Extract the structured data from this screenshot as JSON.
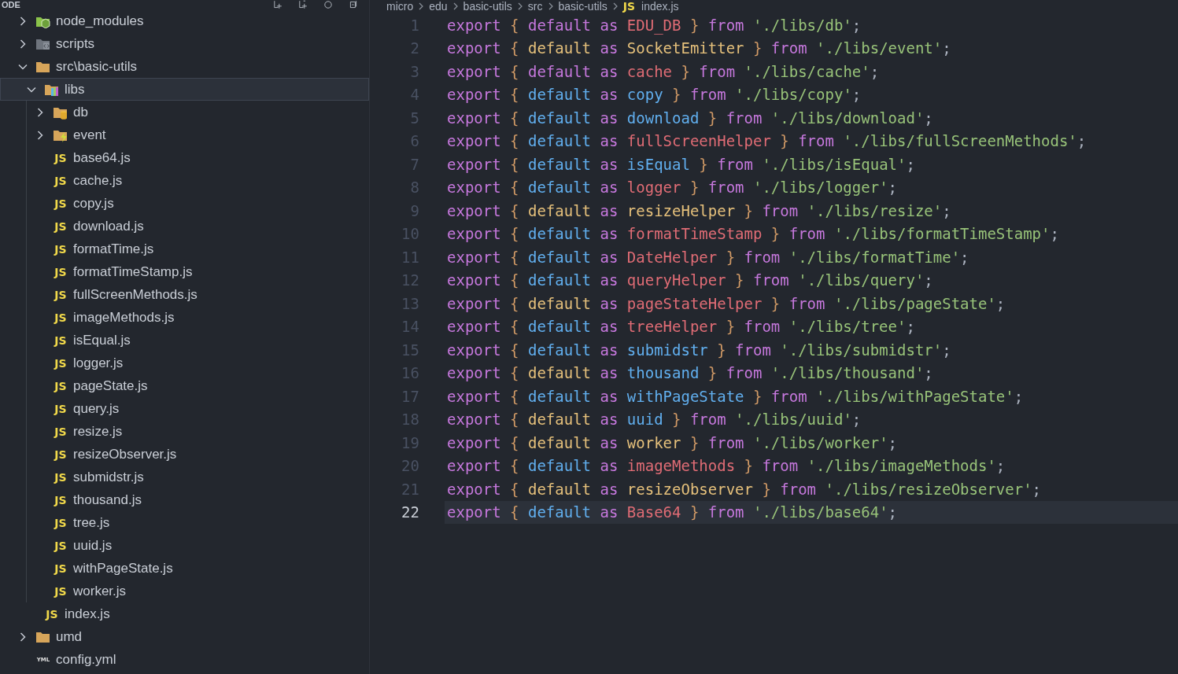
{
  "explorer": {
    "title": "ODE",
    "tree": [
      {
        "label": "node_modules",
        "kind": "node-folder",
        "expanded": false,
        "selected": false
      },
      {
        "label": "scripts",
        "kind": "script-folder",
        "expanded": false,
        "selected": false
      },
      {
        "label": "src\\basic-utils",
        "kind": "folder",
        "expanded": true,
        "selected": false,
        "children": [
          {
            "label": "libs",
            "kind": "lib-folder",
            "expanded": true,
            "selected": true,
            "children": [
              {
                "label": "db",
                "kind": "db-folder",
                "expanded": false,
                "selected": false
              },
              {
                "label": "event",
                "kind": "event-folder",
                "expanded": false,
                "selected": false
              },
              {
                "label": "base64.js",
                "kind": "file",
                "badge": "JS",
                "selected": false
              },
              {
                "label": "cache.js",
                "kind": "file",
                "badge": "JS",
                "selected": false
              },
              {
                "label": "copy.js",
                "kind": "file",
                "badge": "JS",
                "selected": false
              },
              {
                "label": "download.js",
                "kind": "file",
                "badge": "JS",
                "selected": false
              },
              {
                "label": "formatTime.js",
                "kind": "file",
                "badge": "JS",
                "selected": false
              },
              {
                "label": "formatTimeStamp.js",
                "kind": "file",
                "badge": "JS",
                "selected": false
              },
              {
                "label": "fullScreenMethods.js",
                "kind": "file",
                "badge": "JS",
                "selected": false
              },
              {
                "label": "imageMethods.js",
                "kind": "file",
                "badge": "JS",
                "selected": false
              },
              {
                "label": "isEqual.js",
                "kind": "file",
                "badge": "JS",
                "selected": false
              },
              {
                "label": "logger.js",
                "kind": "file",
                "badge": "JS",
                "selected": false
              },
              {
                "label": "pageState.js",
                "kind": "file",
                "badge": "JS",
                "selected": false
              },
              {
                "label": "query.js",
                "kind": "file",
                "badge": "JS",
                "selected": false
              },
              {
                "label": "resize.js",
                "kind": "file",
                "badge": "JS",
                "selected": false
              },
              {
                "label": "resizeObserver.js",
                "kind": "file",
                "badge": "JS",
                "selected": false
              },
              {
                "label": "submidstr.js",
                "kind": "file",
                "badge": "JS",
                "selected": false
              },
              {
                "label": "thousand.js",
                "kind": "file",
                "badge": "JS",
                "selected": false
              },
              {
                "label": "tree.js",
                "kind": "file",
                "badge": "JS",
                "selected": false
              },
              {
                "label": "uuid.js",
                "kind": "file",
                "badge": "JS",
                "selected": false
              },
              {
                "label": "withPageState.js",
                "kind": "file",
                "badge": "JS",
                "selected": false
              },
              {
                "label": "worker.js",
                "kind": "file",
                "badge": "JS",
                "selected": false
              }
            ]
          },
          {
            "label": "index.js",
            "kind": "file",
            "badge": "JS",
            "selected": false
          }
        ]
      },
      {
        "label": "umd",
        "kind": "folder",
        "expanded": false,
        "selected": false
      },
      {
        "label": "config.yml",
        "kind": "file",
        "badge": "YML",
        "selected": false
      }
    ]
  },
  "editor": {
    "breadcrumbs": [
      {
        "text": "micro"
      },
      {
        "text": "edu"
      },
      {
        "text": "basic-utils"
      },
      {
        "text": "src"
      },
      {
        "text": "basic-utils"
      },
      {
        "text": "index.js",
        "badge": "JS"
      }
    ],
    "lines": [
      {
        "number": "1",
        "current": false,
        "end": ";",
        "tokens": [
          {
            "text": "export",
            "color": "#c678dd"
          },
          {
            "text": "{",
            "color": "#d19a66"
          },
          {
            "text": "default",
            "color": "#c678dd"
          },
          {
            "text": "as",
            "color": "#c678dd"
          },
          {
            "text": "EDU_DB",
            "color": "#e06c75"
          },
          {
            "text": "}",
            "color": "#d19a66"
          },
          {
            "text": "from",
            "color": "#c678dd"
          },
          {
            "text": "'./libs/db'",
            "color": "#98c379"
          }
        ]
      },
      {
        "number": "2",
        "current": false,
        "end": ";",
        "tokens": [
          {
            "text": "export",
            "color": "#c678dd"
          },
          {
            "text": "{",
            "color": "#d19a66"
          },
          {
            "text": "default",
            "color": "#e5c07b"
          },
          {
            "text": "as",
            "color": "#c678dd"
          },
          {
            "text": "SocketEmitter",
            "color": "#e5c07b"
          },
          {
            "text": "}",
            "color": "#d19a66"
          },
          {
            "text": "from",
            "color": "#c678dd"
          },
          {
            "text": "'./libs/event'",
            "color": "#98c379"
          }
        ]
      },
      {
        "number": "3",
        "current": false,
        "end": ";",
        "tokens": [
          {
            "text": "export",
            "color": "#c678dd"
          },
          {
            "text": "{",
            "color": "#d19a66"
          },
          {
            "text": "default",
            "color": "#c678dd"
          },
          {
            "text": "as",
            "color": "#c678dd"
          },
          {
            "text": "cache",
            "color": "#e06c75"
          },
          {
            "text": "}",
            "color": "#d19a66"
          },
          {
            "text": "from",
            "color": "#c678dd"
          },
          {
            "text": "'./libs/cache'",
            "color": "#98c379"
          }
        ]
      },
      {
        "number": "4",
        "current": false,
        "end": ";",
        "tokens": [
          {
            "text": "export",
            "color": "#c678dd"
          },
          {
            "text": "{",
            "color": "#d19a66"
          },
          {
            "text": "default",
            "color": "#61afef"
          },
          {
            "text": "as",
            "color": "#c678dd"
          },
          {
            "text": "copy",
            "color": "#61afef"
          },
          {
            "text": "}",
            "color": "#d19a66"
          },
          {
            "text": "from",
            "color": "#c678dd"
          },
          {
            "text": "'./libs/copy'",
            "color": "#98c379"
          }
        ]
      },
      {
        "number": "5",
        "current": false,
        "end": ";",
        "tokens": [
          {
            "text": "export",
            "color": "#c678dd"
          },
          {
            "text": "{",
            "color": "#d19a66"
          },
          {
            "text": "default",
            "color": "#61afef"
          },
          {
            "text": "as",
            "color": "#c678dd"
          },
          {
            "text": "download",
            "color": "#61afef"
          },
          {
            "text": "}",
            "color": "#d19a66"
          },
          {
            "text": "from",
            "color": "#c678dd"
          },
          {
            "text": "'./libs/download'",
            "color": "#98c379"
          }
        ]
      },
      {
        "number": "6",
        "current": false,
        "end": ";",
        "tokens": [
          {
            "text": "export",
            "color": "#c678dd"
          },
          {
            "text": "{",
            "color": "#d19a66"
          },
          {
            "text": "default",
            "color": "#61afef"
          },
          {
            "text": "as",
            "color": "#c678dd"
          },
          {
            "text": "fullScreenHelper",
            "color": "#e06c75"
          },
          {
            "text": "}",
            "color": "#d19a66"
          },
          {
            "text": "from",
            "color": "#c678dd"
          },
          {
            "text": "'./libs/fullScreenMethods'",
            "color": "#98c379"
          }
        ]
      },
      {
        "number": "7",
        "current": false,
        "end": ";",
        "tokens": [
          {
            "text": "export",
            "color": "#c678dd"
          },
          {
            "text": "{",
            "color": "#d19a66"
          },
          {
            "text": "default",
            "color": "#61afef"
          },
          {
            "text": "as",
            "color": "#c678dd"
          },
          {
            "text": "isEqual",
            "color": "#61afef"
          },
          {
            "text": "}",
            "color": "#d19a66"
          },
          {
            "text": "from",
            "color": "#c678dd"
          },
          {
            "text": "'./libs/isEqual'",
            "color": "#98c379"
          }
        ]
      },
      {
        "number": "8",
        "current": false,
        "end": ";",
        "tokens": [
          {
            "text": "export",
            "color": "#c678dd"
          },
          {
            "text": "{",
            "color": "#d19a66"
          },
          {
            "text": "default",
            "color": "#61afef"
          },
          {
            "text": "as",
            "color": "#c678dd"
          },
          {
            "text": "logger",
            "color": "#e06c75"
          },
          {
            "text": "}",
            "color": "#d19a66"
          },
          {
            "text": "from",
            "color": "#c678dd"
          },
          {
            "text": "'./libs/logger'",
            "color": "#98c379"
          }
        ]
      },
      {
        "number": "9",
        "current": false,
        "end": ";",
        "tokens": [
          {
            "text": "export",
            "color": "#c678dd"
          },
          {
            "text": "{",
            "color": "#d19a66"
          },
          {
            "text": "default",
            "color": "#e5c07b"
          },
          {
            "text": "as",
            "color": "#c678dd"
          },
          {
            "text": "resizeHelper",
            "color": "#e5c07b"
          },
          {
            "text": "}",
            "color": "#d19a66"
          },
          {
            "text": "from",
            "color": "#c678dd"
          },
          {
            "text": "'./libs/resize'",
            "color": "#98c379"
          }
        ]
      },
      {
        "number": "10",
        "current": false,
        "end": ";",
        "tokens": [
          {
            "text": "export",
            "color": "#c678dd"
          },
          {
            "text": "{",
            "color": "#d19a66"
          },
          {
            "text": "default",
            "color": "#61afef"
          },
          {
            "text": "as",
            "color": "#c678dd"
          },
          {
            "text": "formatTimeStamp",
            "color": "#e06c75"
          },
          {
            "text": "}",
            "color": "#d19a66"
          },
          {
            "text": "from",
            "color": "#c678dd"
          },
          {
            "text": "'./libs/formatTimeStamp'",
            "color": "#98c379"
          }
        ]
      },
      {
        "number": "11",
        "current": false,
        "end": ";",
        "tokens": [
          {
            "text": "export",
            "color": "#c678dd"
          },
          {
            "text": "{",
            "color": "#d19a66"
          },
          {
            "text": "default",
            "color": "#61afef"
          },
          {
            "text": "as",
            "color": "#c678dd"
          },
          {
            "text": "DateHelper",
            "color": "#e06c75"
          },
          {
            "text": "}",
            "color": "#d19a66"
          },
          {
            "text": "from",
            "color": "#c678dd"
          },
          {
            "text": "'./libs/formatTime'",
            "color": "#98c379"
          }
        ]
      },
      {
        "number": "12",
        "current": false,
        "end": ";",
        "tokens": [
          {
            "text": "export",
            "color": "#c678dd"
          },
          {
            "text": "{",
            "color": "#d19a66"
          },
          {
            "text": "default",
            "color": "#61afef"
          },
          {
            "text": "as",
            "color": "#c678dd"
          },
          {
            "text": "queryHelper",
            "color": "#e06c75"
          },
          {
            "text": "}",
            "color": "#d19a66"
          },
          {
            "text": "from",
            "color": "#c678dd"
          },
          {
            "text": "'./libs/query'",
            "color": "#98c379"
          }
        ]
      },
      {
        "number": "13",
        "current": false,
        "end": ";",
        "tokens": [
          {
            "text": "export",
            "color": "#c678dd"
          },
          {
            "text": "{",
            "color": "#d19a66"
          },
          {
            "text": "default",
            "color": "#e5c07b"
          },
          {
            "text": "as",
            "color": "#c678dd"
          },
          {
            "text": "pageStateHelper",
            "color": "#e06c75"
          },
          {
            "text": "}",
            "color": "#d19a66"
          },
          {
            "text": "from",
            "color": "#c678dd"
          },
          {
            "text": "'./libs/pageState'",
            "color": "#98c379"
          }
        ]
      },
      {
        "number": "14",
        "current": false,
        "end": ";",
        "tokens": [
          {
            "text": "export",
            "color": "#c678dd"
          },
          {
            "text": "{",
            "color": "#d19a66"
          },
          {
            "text": "default",
            "color": "#61afef"
          },
          {
            "text": "as",
            "color": "#c678dd"
          },
          {
            "text": "treeHelper",
            "color": "#e06c75"
          },
          {
            "text": "}",
            "color": "#d19a66"
          },
          {
            "text": "from",
            "color": "#c678dd"
          },
          {
            "text": "'./libs/tree'",
            "color": "#98c379"
          }
        ]
      },
      {
        "number": "15",
        "current": false,
        "end": ";",
        "tokens": [
          {
            "text": "export",
            "color": "#c678dd"
          },
          {
            "text": "{",
            "color": "#d19a66"
          },
          {
            "text": "default",
            "color": "#61afef"
          },
          {
            "text": "as",
            "color": "#c678dd"
          },
          {
            "text": "submidstr",
            "color": "#61afef"
          },
          {
            "text": "}",
            "color": "#d19a66"
          },
          {
            "text": "from",
            "color": "#c678dd"
          },
          {
            "text": "'./libs/submidstr'",
            "color": "#98c379"
          }
        ]
      },
      {
        "number": "16",
        "current": false,
        "end": ";",
        "tokens": [
          {
            "text": "export",
            "color": "#c678dd"
          },
          {
            "text": "{",
            "color": "#d19a66"
          },
          {
            "text": "default",
            "color": "#e5c07b"
          },
          {
            "text": "as",
            "color": "#c678dd"
          },
          {
            "text": "thousand",
            "color": "#61afef"
          },
          {
            "text": "}",
            "color": "#d19a66"
          },
          {
            "text": "from",
            "color": "#c678dd"
          },
          {
            "text": "'./libs/thousand'",
            "color": "#98c379"
          }
        ]
      },
      {
        "number": "17",
        "current": false,
        "end": ";",
        "tokens": [
          {
            "text": "export",
            "color": "#c678dd"
          },
          {
            "text": "{",
            "color": "#d19a66"
          },
          {
            "text": "default",
            "color": "#61afef"
          },
          {
            "text": "as",
            "color": "#c678dd"
          },
          {
            "text": "withPageState",
            "color": "#61afef"
          },
          {
            "text": "}",
            "color": "#d19a66"
          },
          {
            "text": "from",
            "color": "#c678dd"
          },
          {
            "text": "'./libs/withPageState'",
            "color": "#98c379"
          }
        ]
      },
      {
        "number": "18",
        "current": false,
        "end": ";",
        "tokens": [
          {
            "text": "export",
            "color": "#c678dd"
          },
          {
            "text": "{",
            "color": "#d19a66"
          },
          {
            "text": "default",
            "color": "#e5c07b"
          },
          {
            "text": "as",
            "color": "#c678dd"
          },
          {
            "text": "uuid",
            "color": "#61afef"
          },
          {
            "text": "}",
            "color": "#d19a66"
          },
          {
            "text": "from",
            "color": "#c678dd"
          },
          {
            "text": "'./libs/uuid'",
            "color": "#98c379"
          }
        ]
      },
      {
        "number": "19",
        "current": false,
        "end": ";",
        "tokens": [
          {
            "text": "export",
            "color": "#c678dd"
          },
          {
            "text": "{",
            "color": "#d19a66"
          },
          {
            "text": "default",
            "color": "#e5c07b"
          },
          {
            "text": "as",
            "color": "#c678dd"
          },
          {
            "text": "worker",
            "color": "#e5c07b"
          },
          {
            "text": "}",
            "color": "#d19a66"
          },
          {
            "text": "from",
            "color": "#c678dd"
          },
          {
            "text": "'./libs/worker'",
            "color": "#98c379"
          }
        ]
      },
      {
        "number": "20",
        "current": false,
        "end": ";",
        "tokens": [
          {
            "text": "export",
            "color": "#c678dd"
          },
          {
            "text": "{",
            "color": "#d19a66"
          },
          {
            "text": "default",
            "color": "#61afef"
          },
          {
            "text": "as",
            "color": "#c678dd"
          },
          {
            "text": "imageMethods",
            "color": "#e06c75"
          },
          {
            "text": "}",
            "color": "#d19a66"
          },
          {
            "text": "from",
            "color": "#c678dd"
          },
          {
            "text": "'./libs/imageMethods'",
            "color": "#98c379"
          }
        ]
      },
      {
        "number": "21",
        "current": false,
        "end": ";",
        "tokens": [
          {
            "text": "export",
            "color": "#c678dd"
          },
          {
            "text": "{",
            "color": "#d19a66"
          },
          {
            "text": "default",
            "color": "#e5c07b"
          },
          {
            "text": "as",
            "color": "#c678dd"
          },
          {
            "text": "resizeObserver",
            "color": "#e5c07b"
          },
          {
            "text": "}",
            "color": "#d19a66"
          },
          {
            "text": "from",
            "color": "#c678dd"
          },
          {
            "text": "'./libs/resizeObserver'",
            "color": "#98c379"
          }
        ]
      },
      {
        "number": "22",
        "current": true,
        "end": ";",
        "tokens": [
          {
            "text": "export",
            "color": "#c678dd"
          },
          {
            "text": "{",
            "color": "#d19a66"
          },
          {
            "text": "default",
            "color": "#61afef"
          },
          {
            "text": "as",
            "color": "#c678dd"
          },
          {
            "text": "Base64",
            "color": "#e06c75"
          },
          {
            "text": "}",
            "color": "#d19a66"
          },
          {
            "text": "from",
            "color": "#c678dd"
          },
          {
            "text": "'./libs/base64'",
            "color": "#98c379"
          }
        ]
      }
    ]
  }
}
